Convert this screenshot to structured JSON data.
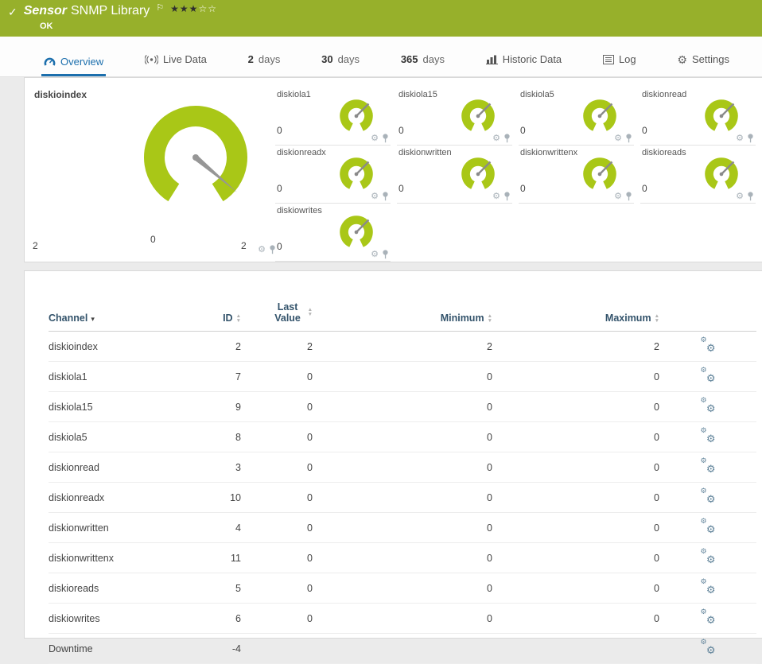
{
  "header": {
    "title_kind": "Sensor",
    "title_name": "SNMP Library",
    "status": "OK",
    "stars_filled": "★★★",
    "stars_empty": "☆☆"
  },
  "tabs": [
    {
      "label": "Overview",
      "icon": "overview-icon",
      "active": true
    },
    {
      "label": "Live Data",
      "icon": "live-data-icon"
    },
    {
      "num": "2",
      "label": "days"
    },
    {
      "num": "30",
      "label": "days"
    },
    {
      "num": "365",
      "label": "days"
    },
    {
      "label": "Historic Data",
      "icon": "historic-data-icon"
    },
    {
      "label": "Log",
      "icon": "log-icon"
    },
    {
      "label": "Settings",
      "icon": "settings-icon"
    }
  ],
  "gauges": {
    "main": {
      "name": "diskioindex",
      "scale_left": "2",
      "scale_center": "0",
      "scale_right": "2"
    },
    "small": [
      {
        "name": "diskiola1",
        "value": "0"
      },
      {
        "name": "diskiola15",
        "value": "0"
      },
      {
        "name": "diskiola5",
        "value": "0"
      },
      {
        "name": "diskionread",
        "value": "0"
      },
      {
        "name": "diskionreadx",
        "value": "0"
      },
      {
        "name": "diskionwritten",
        "value": "0"
      },
      {
        "name": "diskionwrittenx",
        "value": "0"
      },
      {
        "name": "diskioreads",
        "value": "0"
      },
      {
        "name": "diskiowrites",
        "value": "0"
      }
    ]
  },
  "channel_table": {
    "headers": {
      "channel": "Channel",
      "id": "ID",
      "last1": "Last",
      "last2": "Value",
      "minimum": "Minimum",
      "maximum": "Maximum"
    },
    "rows": [
      {
        "channel": "diskioindex",
        "id": "2",
        "last_value": "2",
        "minimum": "2",
        "maximum": "2"
      },
      {
        "channel": "diskiola1",
        "id": "7",
        "last_value": "0",
        "minimum": "0",
        "maximum": "0"
      },
      {
        "channel": "diskiola15",
        "id": "9",
        "last_value": "0",
        "minimum": "0",
        "maximum": "0"
      },
      {
        "channel": "diskiola5",
        "id": "8",
        "last_value": "0",
        "minimum": "0",
        "maximum": "0"
      },
      {
        "channel": "diskionread",
        "id": "3",
        "last_value": "0",
        "minimum": "0",
        "maximum": "0"
      },
      {
        "channel": "diskionreadx",
        "id": "10",
        "last_value": "0",
        "minimum": "0",
        "maximum": "0"
      },
      {
        "channel": "diskionwritten",
        "id": "4",
        "last_value": "0",
        "minimum": "0",
        "maximum": "0"
      },
      {
        "channel": "diskionwrittenx",
        "id": "11",
        "last_value": "0",
        "minimum": "0",
        "maximum": "0"
      },
      {
        "channel": "diskioreads",
        "id": "5",
        "last_value": "0",
        "minimum": "0",
        "maximum": "0"
      },
      {
        "channel": "diskiowrites",
        "id": "6",
        "last_value": "0",
        "minimum": "0",
        "maximum": "0"
      },
      {
        "channel": "Downtime",
        "id": "-4",
        "last_value": "",
        "minimum": "",
        "maximum": ""
      }
    ]
  },
  "colors": {
    "header_green": "#97b02b",
    "gauge_green": "#a9c717",
    "active_tab_blue": "#1c6fad"
  }
}
